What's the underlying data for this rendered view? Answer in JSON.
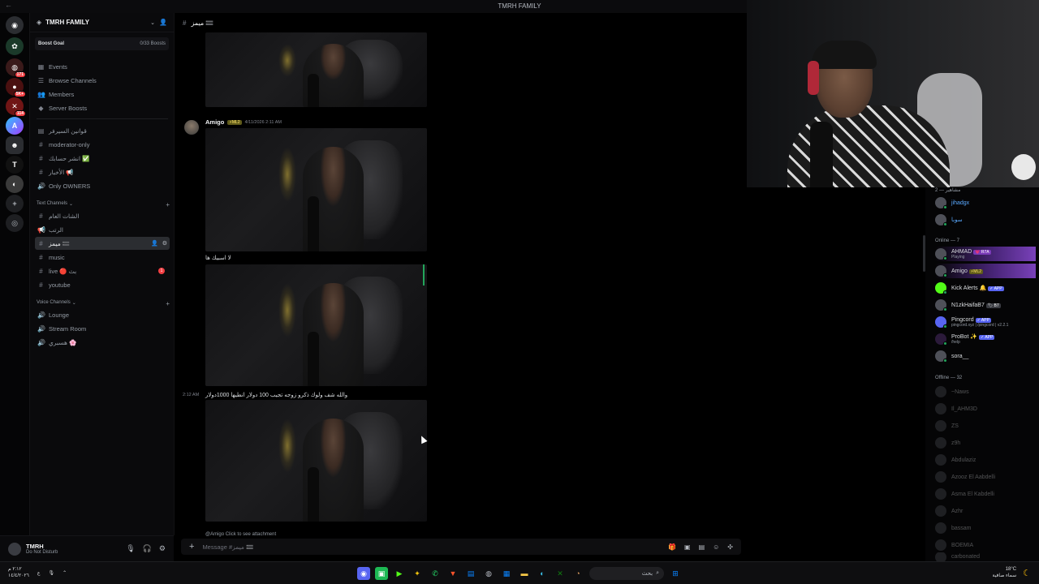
{
  "window": {
    "title": "TMRH FAMILY"
  },
  "server": {
    "name": "TMRH FAMILY",
    "boost_label": "Boost Goal",
    "boost_count": "0/33 Boosts"
  },
  "rail": {
    "badges": [
      "171",
      "5K+",
      "114"
    ],
    "letter_a": "A",
    "letter_t": "T"
  },
  "sidebar": {
    "top_items": [
      "Events",
      "Browse Channels",
      "Members",
      "Server Boosts"
    ],
    "pinned": [
      "قوانين السيرفر",
      "moderator-only",
      "انشر حسابك ✅",
      "الأخبار 📢",
      "Only OWNERS"
    ],
    "text_category": "Text Channels",
    "text_channels": [
      "الشات العام",
      "الرتب",
      "ميمز 🟰",
      "music",
      "live 🔴 بث",
      "youtube"
    ],
    "voice_category": "Voice Channels",
    "voice_channels": [
      "Lounge",
      "Stream Room",
      "هسبري 🌸"
    ],
    "unread_badge": "1"
  },
  "user": {
    "name": "TMRH",
    "status": "Do Not Disturb"
  },
  "chat": {
    "channel": "ميمز 🟰",
    "author": "Amigo",
    "author_tag": "⚡ML2",
    "timestamp": "4/11/2026 2:11 AM",
    "message1": "لا اسبيك ها",
    "time2": "2:12 AM",
    "message2": "والله شف ولوك ذكرو زوجه تجيب 100 دولار انطيها 1000دولار",
    "reply_preview": "@Amigo  Click to see attachment",
    "composer_placeholder": "Message #ميمز 🟰"
  },
  "members": {
    "group_top": "مشاهير — 2",
    "top": [
      "jihadgx",
      "سوبا"
    ],
    "online_label": "Online — 7",
    "online": [
      {
        "name": "AHMAD",
        "tag": "💗 R7A",
        "sub": "Playing"
      },
      {
        "name": "Amigo",
        "tag": "⚡ML2",
        "sub": ""
      },
      {
        "name": "Kick Alerts 🔔",
        "tag": "✓ APP",
        "sub": ""
      },
      {
        "name": "N1zkHaifaB7",
        "tag": "🏷 B7",
        "sub": ""
      },
      {
        "name": "Pingcord",
        "tag": "✓ APP",
        "sub": "pingcord.xyz | /pingcord | v2.2.1"
      },
      {
        "name": "ProBot ✨",
        "tag": "✓ APP",
        "sub": "/help"
      },
      {
        "name": "sora__",
        "tag": "",
        "sub": ""
      }
    ],
    "offline_label": "Offline — 32",
    "offline": [
      "~Naws",
      "Il_AHM3D",
      "ZS",
      "z9h",
      "Abdulaziz",
      "Azooz El Aabdelli",
      "Asma El Kabdelli",
      "Azhr",
      "bassam",
      "BOEMIA",
      "carbonated"
    ]
  },
  "taskbar": {
    "time": "٢:١٢ م",
    "date": "١٤/٤/٢٠٢٦",
    "lang": "ع",
    "search": "بحث",
    "weather_temp": "18°C",
    "weather_text": "سماء صافية"
  }
}
